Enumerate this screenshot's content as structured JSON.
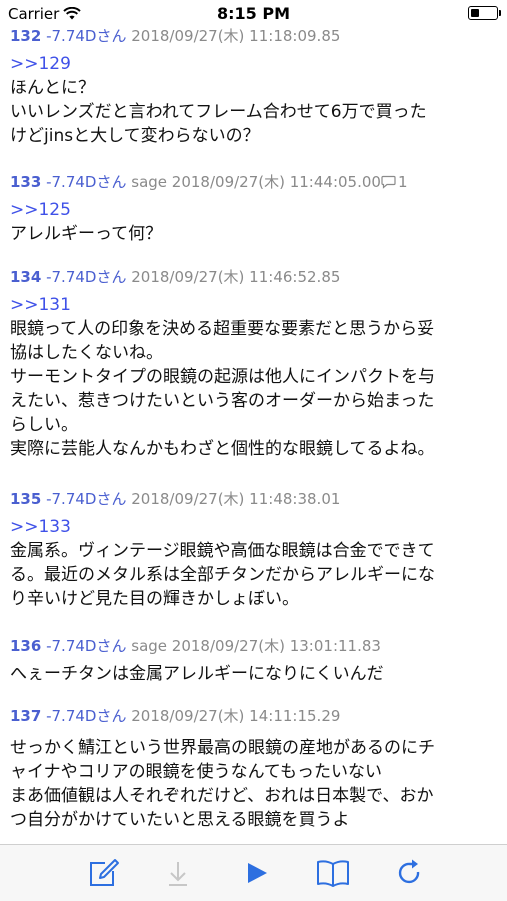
{
  "status_bar": {
    "carrier": "Carrier",
    "time": "8:15 PM",
    "battery_level": 0.35
  },
  "posts": [
    {
      "num": "132",
      "name": "-7.74Dさん",
      "mail": "",
      "date": "2018/09/27(木) 11:18:09.85",
      "reply_count": "",
      "anchor": ">>129",
      "lines": [
        "ほんとに？",
        "いいレンズだと言われてフレーム合わせて6万で買った",
        "けどjinsと大して変わらないの？"
      ]
    },
    {
      "num": "133",
      "name": "-7.74Dさん",
      "mail": "sage",
      "date": "2018/09/27(木) 11:44:05.00",
      "reply_count": "1",
      "anchor": ">>125",
      "lines": [
        "アレルギーって何？"
      ]
    },
    {
      "num": "134",
      "name": "-7.74Dさん",
      "mail": "",
      "date": "2018/09/27(木) 11:46:52.85",
      "reply_count": "",
      "anchor": ">>131",
      "lines": [
        "眼鏡って人の印象を決める超重要な要素だと思うから妥",
        "協はしたくないね。",
        "サーモントタイプの眼鏡の起源は他人にインパクトを与",
        "えたい、惹きつけたいという客のオーダーから始まった",
        "らしい。",
        "実際に芸能人なんかもわざと個性的な眼鏡してるよね。"
      ]
    },
    {
      "num": "135",
      "name": "-7.74Dさん",
      "mail": "",
      "date": "2018/09/27(木) 11:48:38.01",
      "reply_count": "",
      "anchor": ">>133",
      "lines": [
        "金属系。ヴィンテージ眼鏡や高価な眼鏡は合金でできて",
        "る。最近のメタル系は全部チタンだからアレルギーにな",
        "り辛いけど見た目の輝きかしょぼい。"
      ]
    },
    {
      "num": "136",
      "name": "-7.74Dさん",
      "mail": "sage",
      "date": "2018/09/27(木) 13:01:11.83",
      "reply_count": "",
      "anchor": "",
      "lines": [
        "へぇーチタンは金属アレルギーになりにくいんだ"
      ]
    },
    {
      "num": "137",
      "name": "-7.74Dさん",
      "mail": "",
      "date": "2018/09/27(木) 14:11:15.29",
      "reply_count": "",
      "anchor": "",
      "lines": [
        "せっかく鯖江という世界最高の眼鏡の産地があるのにチ",
        "ャイナやコリアの眼鏡を使うなんてもったいない",
        "まあ価値観は人それぞれだけど、おれは日本製で、おか",
        "つ自分がかけていたいと思える眼鏡を買うよ"
      ]
    }
  ],
  "toolbar": {
    "icons": [
      "compose-icon",
      "download-icon",
      "play-icon",
      "book-icon",
      "refresh-icon"
    ],
    "accent_color": "#2d6fe0",
    "disabled_color": "#c7c7c7"
  }
}
